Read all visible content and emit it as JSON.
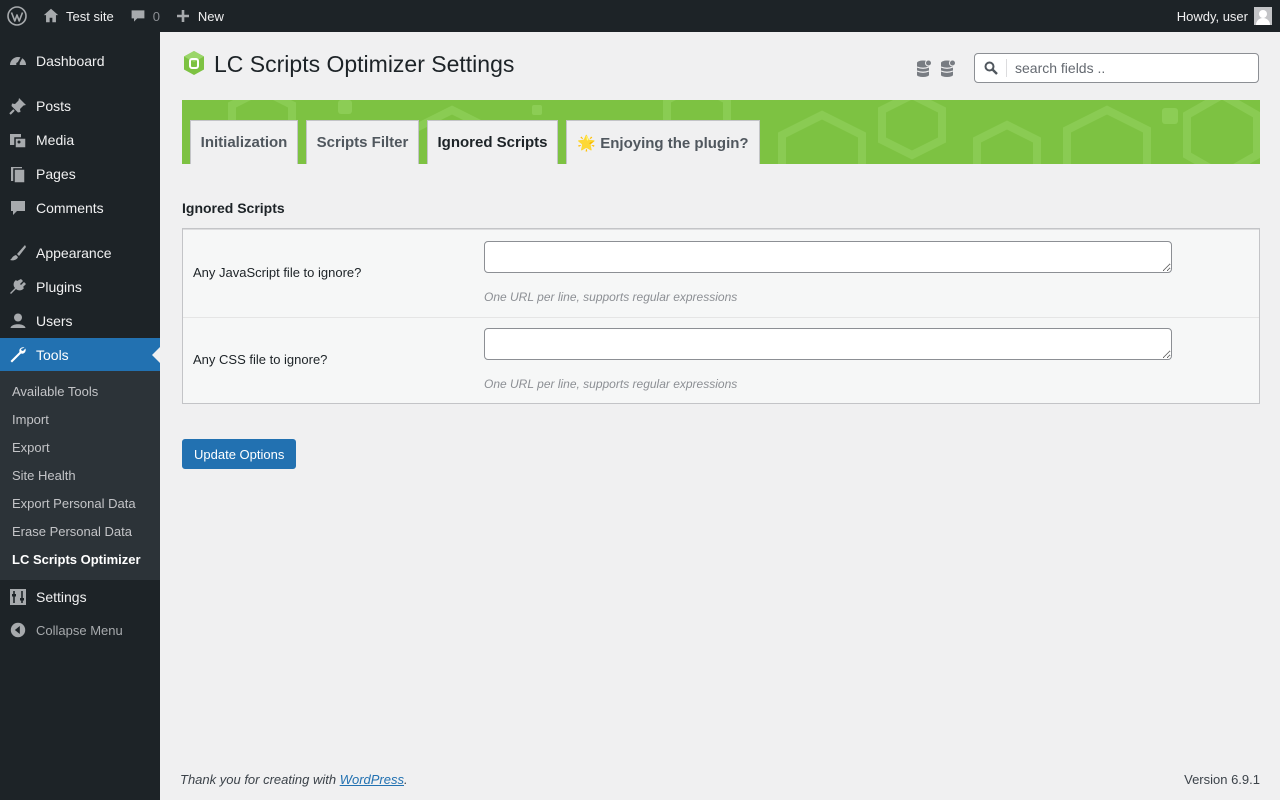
{
  "adminbar": {
    "site_name": "Test site",
    "comments_count": "0",
    "new_label": "New",
    "howdy": "Howdy, user"
  },
  "sidebar": {
    "items": [
      {
        "label": "Dashboard",
        "icon": "dashboard-icon"
      },
      {
        "label": "Posts",
        "icon": "pin-icon"
      },
      {
        "label": "Media",
        "icon": "media-icon"
      },
      {
        "label": "Pages",
        "icon": "pages-icon"
      },
      {
        "label": "Comments",
        "icon": "comment-icon"
      },
      {
        "label": "Appearance",
        "icon": "brush-icon"
      },
      {
        "label": "Plugins",
        "icon": "plugin-icon"
      },
      {
        "label": "Users",
        "icon": "user-icon"
      },
      {
        "label": "Tools",
        "icon": "wrench-icon"
      },
      {
        "label": "Settings",
        "icon": "settings-icon"
      }
    ],
    "submenu": [
      "Available Tools",
      "Import",
      "Export",
      "Site Health",
      "Export Personal Data",
      "Erase Personal Data",
      "LC Scripts Optimizer"
    ],
    "collapse_label": "Collapse Menu"
  },
  "page": {
    "title": "LC Scripts Optimizer Settings",
    "search_placeholder": "search fields .."
  },
  "tabs": [
    "Initialization",
    "Scripts Filter",
    "Ignored Scripts",
    "🌟 Enjoying the plugin?"
  ],
  "active_tab": "Ignored Scripts",
  "section": {
    "title": "Ignored Scripts",
    "rows": [
      {
        "label": "Any JavaScript file to ignore?",
        "value": "",
        "description": "One URL per line, supports regular expressions"
      },
      {
        "label": "Any CSS file to ignore?",
        "value": "",
        "description": "One URL per line, supports regular expressions"
      }
    ]
  },
  "submit_label": "Update Options",
  "footer": {
    "thanks_prefix": "Thank you for creating with ",
    "thanks_link": "WordPress",
    "thanks_suffix": ".",
    "version": "Version 6.9.1"
  },
  "colors": {
    "adminbar_bg": "#1d2327",
    "menu_current": "#2271b1",
    "banner_green": "#7dc242",
    "primary_button": "#2271b1"
  }
}
